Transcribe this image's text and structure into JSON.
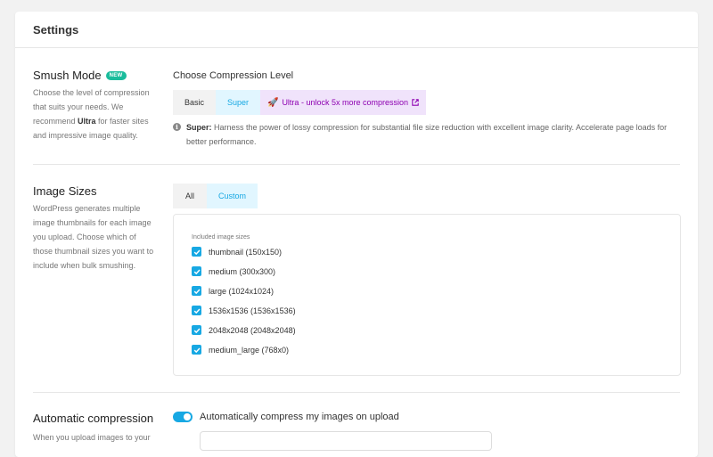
{
  "header": {
    "title": "Settings"
  },
  "smush_mode": {
    "title": "Smush Mode",
    "badge": "NEW",
    "desc_pre": "Choose the level of compression that suits your needs. We recommend ",
    "desc_bold": "Ultra",
    "desc_post": " for faster sites and impressive image quality.",
    "level_title": "Choose Compression Level",
    "levels": {
      "basic": "Basic",
      "super": "Super",
      "ultra": "Ultra - unlock 5x more compression"
    },
    "selected": "Super",
    "note_bold": "Super:",
    "note_text": " Harness the power of lossy compression for substantial file size reduction with excellent image clarity. Accelerate page loads for better performance."
  },
  "image_sizes": {
    "title": "Image Sizes",
    "desc": "WordPress generates multiple image thumbnails for each image you upload. Choose which of those thumbnail sizes you want to include when bulk smushing.",
    "tabs": {
      "all": "All",
      "custom": "Custom"
    },
    "selected_tab": "Custom",
    "included_label": "Included image sizes",
    "sizes": [
      {
        "label": "thumbnail (150x150)",
        "checked": true
      },
      {
        "label": "medium (300x300)",
        "checked": true
      },
      {
        "label": "large (1024x1024)",
        "checked": true
      },
      {
        "label": "1536x1536 (1536x1536)",
        "checked": true
      },
      {
        "label": "2048x2048 (2048x2048)",
        "checked": true
      },
      {
        "label": "medium_large (768x0)",
        "checked": true
      }
    ]
  },
  "auto_compression": {
    "title": "Automatic compression",
    "desc": "When you upload images to your",
    "toggle_label": "Automatically compress my images on upload",
    "toggle_on": true
  },
  "colors": {
    "accent": "#17a8e3",
    "ultra": "#8d00b1",
    "badge": "#1abc9c"
  },
  "icons": {
    "ultra": "rocket-icon",
    "external": "external-link-icon",
    "info": "info-icon",
    "check": "check-icon"
  }
}
